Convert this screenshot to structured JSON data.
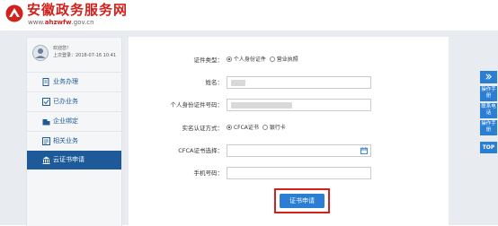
{
  "brand": {
    "title": "安徽政务服务网",
    "url_prefix": "www.",
    "url_highlight": "ahzwfw",
    "url_suffix": ".gov.cn",
    "color": "#d0211c"
  },
  "user": {
    "welcome": "欢迎您！",
    "last_login": "上次登录：2018-07-16 10:41"
  },
  "sidebar": {
    "items": [
      {
        "label": "业务办理",
        "icon": "business-icon",
        "active": false
      },
      {
        "label": "已办业务",
        "icon": "done-icon",
        "active": false
      },
      {
        "label": "企业绑定",
        "icon": "enterprise-icon",
        "active": false
      },
      {
        "label": "相关业务",
        "icon": "related-icon",
        "active": false
      },
      {
        "label": "云证书申请",
        "icon": "bank-icon",
        "active": true
      }
    ],
    "active_color": "#1e5a9a"
  },
  "form": {
    "cert_type_label": "证件类型：",
    "cert_type_options": [
      "个人身份证件",
      "营业执照"
    ],
    "cert_type_selected": "个人身份证件",
    "name_label": "姓名：",
    "id_label": "个人身份证件号码：",
    "auth_label": "实名认证方式：",
    "auth_options": [
      "CFCA证书",
      "银行卡"
    ],
    "auth_selected": "CFCA证书",
    "cfca_label": "CFCA证书选择：",
    "phone_label": "手机号码：",
    "submit_label": "证书申请"
  },
  "rail": {
    "items": [
      "操作手册",
      "联系电话",
      "操作手册"
    ],
    "top_label": "TOP",
    "color": "#2a7fd4"
  }
}
